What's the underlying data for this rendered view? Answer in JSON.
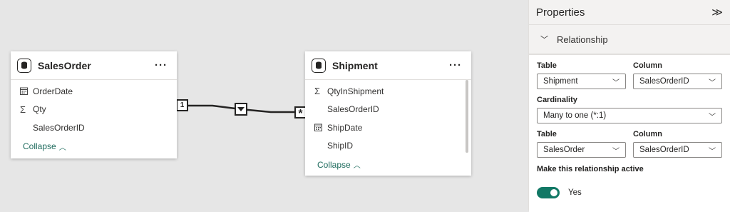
{
  "tables": [
    {
      "title": "SalesOrder",
      "icon": "database-icon",
      "more": "···",
      "fields": [
        {
          "icon": "calendar-icon",
          "name": "OrderDate"
        },
        {
          "icon": "sigma-icon",
          "name": "Qty"
        },
        {
          "icon": "",
          "name": "SalesOrderID"
        }
      ],
      "collapse": "Collapse"
    },
    {
      "title": "Shipment",
      "icon": "database-icon",
      "more": "···",
      "fields": [
        {
          "icon": "sigma-icon",
          "name": "QtyInShipment"
        },
        {
          "icon": "",
          "name": "SalesOrderID"
        },
        {
          "icon": "calendar-icon",
          "name": "ShipDate"
        },
        {
          "icon": "",
          "name": "ShipID"
        }
      ],
      "collapse": "Collapse"
    }
  ],
  "relationship": {
    "one_marker": "1",
    "many_marker": "*",
    "filter_direction": "single"
  },
  "properties": {
    "title": "Properties",
    "section": "Relationship",
    "table1_label": "Table",
    "column1_label": "Column",
    "table1_value": "Shipment",
    "column1_value": "SalesOrderID",
    "cardinality_label": "Cardinality",
    "cardinality_value": "Many to one (*:1)",
    "table2_label": "Table",
    "column2_label": "Column",
    "table2_value": "SalesOrder",
    "column2_value": "SalesOrderID",
    "active_label": "Make this relationship active",
    "active_value": "Yes"
  },
  "colors": {
    "canvas": "#e6e6e6",
    "accent": "#117865",
    "link": "#1e6b5d"
  }
}
